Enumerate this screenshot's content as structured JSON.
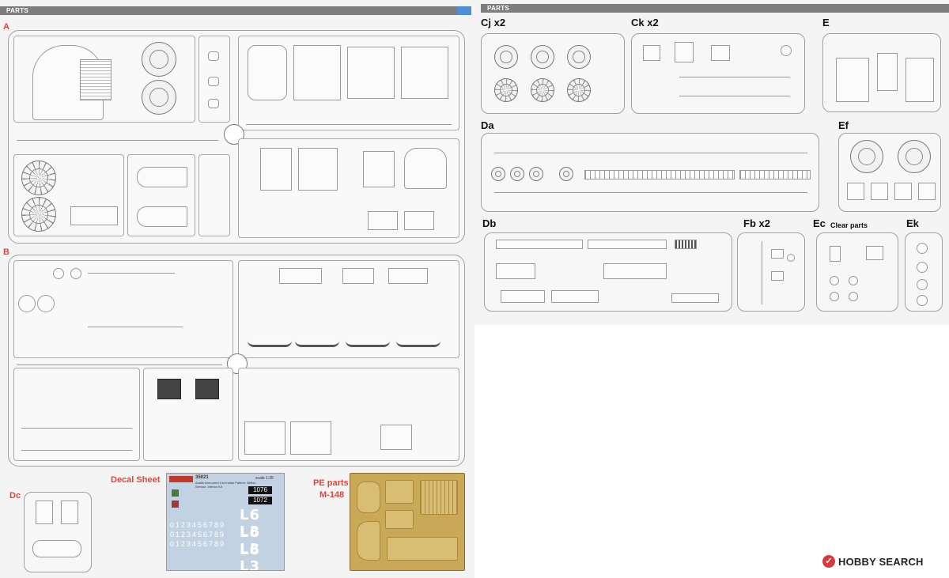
{
  "left_page": {
    "header": "PARTS",
    "sprues": {
      "a": "A",
      "b": "B",
      "dc": "Dc"
    },
    "decal": {
      "title": "Decal Sheet",
      "sheet_code": "35021",
      "sheet_name": "Austin Armoured Car Indian Pattern. British Service. Interior Kit",
      "scale": "scale 1:35",
      "serial_a": "1076",
      "serial_b": "1072",
      "markings": "L6 L3",
      "digits": "0123456789"
    },
    "pe": {
      "title_line1": "PE parts",
      "title_line2": "M-148"
    }
  },
  "right_page": {
    "header": "PARTS",
    "sprues": {
      "cj": "Cj x2",
      "ck": "Ck x2",
      "e": "E",
      "da": "Da",
      "ef": "Ef",
      "db": "Db",
      "fb": "Fb x2",
      "ec": "Ec",
      "ec_note": "Clear parts",
      "ek": "Ek"
    }
  },
  "watermark": {
    "brand": "HOBBY SEARCH",
    "logo_glyph": "✓"
  }
}
